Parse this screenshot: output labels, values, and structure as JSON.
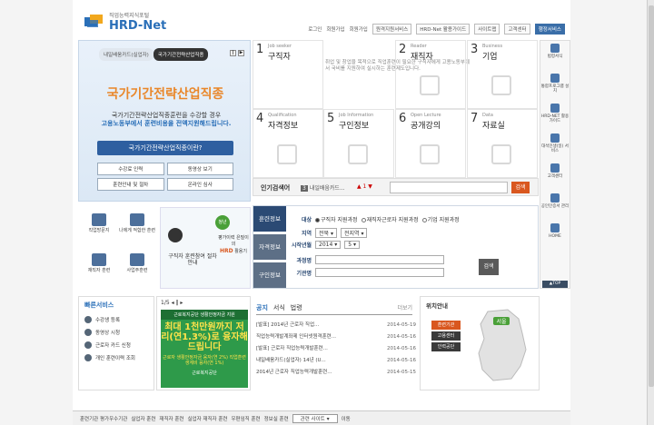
{
  "header": {
    "logo_sub": "직업능력지식포털",
    "logo_main": "HRD-Net",
    "nav": [
      "로그인",
      "회원가입",
      "회원가입",
      "원격지원서비스",
      "HRD-Net 활용가이드",
      "사이트맵",
      "고객센터",
      "행정서비스"
    ]
  },
  "hero": {
    "tab1": "내일배움카드(실업자)",
    "tab2": "국가기간전략산업직종",
    "title": "국가기간전략산업직종",
    "desc1": "국가기간전략산업직종훈련을 수강할 경우",
    "desc2": "고용노동부에서 훈련비용을 전액지원해드립니다.",
    "cta": "국가기간전략산업직종이란?",
    "links": [
      "수강료 인력",
      "동영상 보기",
      "훈련안내 및 절차",
      "온라인 심사"
    ]
  },
  "categories": [
    {
      "num": "1",
      "en": "Job seeker",
      "ko": "구직자"
    },
    {
      "num": "2",
      "en": "Reader",
      "ko": "재직자"
    },
    {
      "num": "3",
      "en": "Business",
      "ko": "기업"
    },
    {
      "num": "4",
      "en": "Qualification",
      "ko": "자격정보"
    },
    {
      "num": "5",
      "en": "Job Information",
      "ko": "구인정보"
    },
    {
      "num": "6",
      "en": "Open Lecture",
      "ko": "공개강의"
    },
    {
      "num": "7",
      "en": "Data",
      "ko": "자료실"
    }
  ],
  "cat_msg": "취업 및 창업을 목적으로 직업훈련이 필요한 구직자에게 고용노동부에서 국비를 지원하여 실시하는 훈련제도입니다.",
  "search": {
    "label": "인기검색어",
    "rank": "3",
    "term": "내일배움카드...",
    "arrows": "▲ 1 ▼",
    "placeholder": "",
    "go": "검색"
  },
  "quick_icons": [
    "직업방문지",
    "나에게 적합한 훈련",
    "재직자 훈련",
    "사업주훈련"
  ],
  "quick_big": {
    "text": "구직자 훈련참여 절차 안내",
    "badge": "청년",
    "t2a": "평가이력 은밀이의",
    "t2b": "HRD",
    "t2c": "활용기"
  },
  "search_form": {
    "tabs": [
      "훈련정보",
      "자격정보",
      "구인정보"
    ],
    "type_label": "대상",
    "types": [
      "구직자 지원과정",
      "재직자근로자 지원과정",
      "기업 지원과정"
    ],
    "region_label": "지역",
    "region1": "전북",
    "region2": "전지역",
    "date_label": "시작년월",
    "year": "2014",
    "month": "5",
    "course_label": "과정명",
    "org_label": "기관명",
    "btn": "검색"
  },
  "rail": [
    "법령서식",
    "통합프로그램 설치",
    "HRD-NET 활용가이드",
    "대석인생(일) 서비스",
    "고객센터",
    "공인인증서 관리",
    "HOME"
  ],
  "rail_top": "▲TOP",
  "quick_service": {
    "title": "빠른서비스",
    "items": [
      "수강생 등록",
      "동영상 시청",
      "근로자 카드 신청",
      "개인 훈련이력 조회"
    ]
  },
  "banner": {
    "page": "1/5",
    "b1": "근로복지공단 생활안정자금 지원",
    "b2": "최대 1천만원까지 저리(연1.3%)로 융자해드립니다",
    "b3": "근로자 생활안정자금 융자(연 2%) 직업훈련생계비 융자(연 1%)",
    "b4": "근로복지공단"
  },
  "notice": {
    "tabs": [
      "공지",
      "서식",
      "법령"
    ],
    "more": "더보기",
    "items": [
      {
        "t": "[발표] 2014년 근로자 직업...",
        "d": "2014-05-19"
      },
      {
        "t": "직업능력개발계좌제 인터넷원격훈련...",
        "d": "2014-05-16"
      },
      {
        "t": "[발표] 근로자 직업능력개발훈련...",
        "d": "2014-05-16"
      },
      {
        "t": "내일배움카드(실업자) 14년 (U...",
        "d": "2014-05-16"
      },
      {
        "t": "2014년 근로자 직업능력개발훈련...",
        "d": "2014-05-15"
      }
    ]
  },
  "location": {
    "title": "위치안내",
    "btns": [
      "훈련기관",
      "고용센터",
      "인력공단"
    ],
    "region": "서울"
  },
  "footer": {
    "items": [
      "훈련기관 평가우수기관",
      "실업자 훈련",
      "재직자 훈련",
      "실업자 재직자 훈련",
      "우편임직 훈련",
      "정보실 훈련"
    ],
    "site_select": "관련 사이트",
    "go": "이동"
  }
}
